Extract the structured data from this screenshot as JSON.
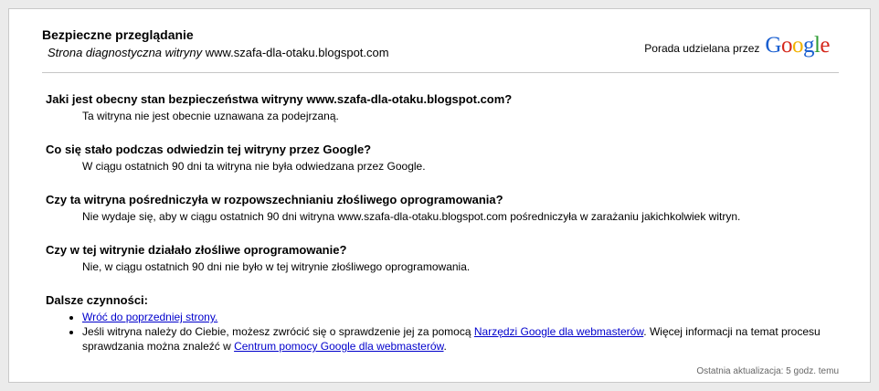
{
  "header": {
    "title": "Bezpieczne przeglądanie",
    "subtitle_label": "Strona diagnostyczna witryny",
    "subtitle_site": "www.szafa-dla-otaku.blogspot.com",
    "advisory_text": "Porada udzielana przez",
    "logo_letters": [
      {
        "ch": "G",
        "color": "#1a5fd0"
      },
      {
        "ch": "o",
        "color": "#d5281c"
      },
      {
        "ch": "o",
        "color": "#f2b200"
      },
      {
        "ch": "g",
        "color": "#1a5fd0"
      },
      {
        "ch": "l",
        "color": "#2f9c34"
      },
      {
        "ch": "e",
        "color": "#d5281c"
      }
    ]
  },
  "sections": [
    {
      "question": "Jaki jest obecny stan bezpieczeństwa witryny www.szafa-dla-otaku.blogspot.com?",
      "answer": "Ta witryna nie jest obecnie uznawana za podejrzaną."
    },
    {
      "question": "Co się stało podczas odwiedzin tej witryny przez Google?",
      "answer": "W ciągu ostatnich 90 dni ta witryna nie była odwiedzana przez Google."
    },
    {
      "question": "Czy ta witryna pośredniczyła w rozpowszechnianiu złośliwego oprogramowania?",
      "answer": "Nie wydaje się, aby w ciągu ostatnich 90 dni witryna www.szafa-dla-otaku.blogspot.com pośredniczyła w zarażaniu jakichkolwiek witryn."
    },
    {
      "question": "Czy w tej witrynie działało złośliwe oprogramowanie?",
      "answer": "Nie, w ciągu ostatnich 90 dni nie było w tej witrynie złośliwego oprogramowania."
    }
  ],
  "next_steps": {
    "heading": "Dalsze czynności:",
    "back_link": "Wróć do poprzedniej strony.",
    "item2_part1": "Jeśli witryna należy do Ciebie, możesz zwrócić się o sprawdzenie jej za pomocą ",
    "item2_link1": "Narzędzi Google dla webmasterów",
    "item2_part2": ". Więcej informacji na temat procesu sprawdzania można znaleźć w ",
    "item2_link2": "Centrum pomocy Google dla webmasterów",
    "item2_part3": "."
  },
  "footer": {
    "last_update": "Ostatnia aktualizacja: 5 godz. temu"
  }
}
